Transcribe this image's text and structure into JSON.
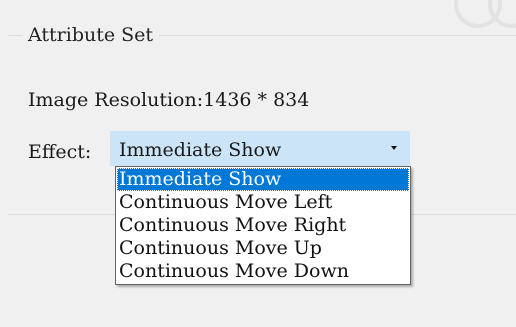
{
  "group": {
    "title": "Attribute Set"
  },
  "resolution": {
    "text": "Image Resolution:1436 * 834"
  },
  "effect": {
    "label": "Effect:",
    "selected": "Immediate Show",
    "options": [
      "Immediate Show",
      "Continuous Move Left",
      "Continuous Move Right",
      "Continuous Move Up",
      "Continuous Move Down"
    ],
    "selected_index": 0
  },
  "colors": {
    "combo_background": "#cce4f7",
    "highlight": "#0078d7",
    "window_background": "#f0f0f0"
  },
  "icons": {
    "combo_arrow": "chevron-down-icon"
  }
}
